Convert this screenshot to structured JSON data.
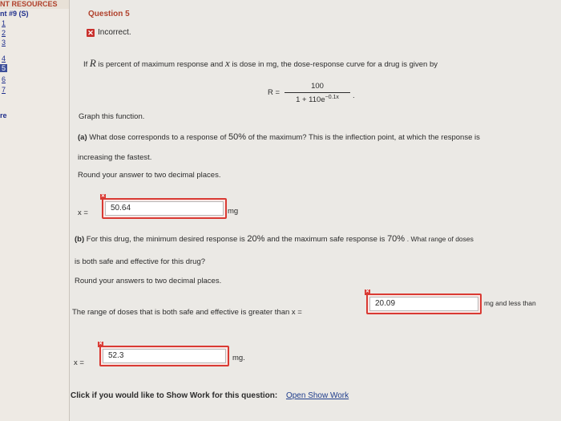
{
  "sidebar": {
    "header": "NT RESOURCES",
    "subheader": "nt #9 (S)",
    "items": [
      {
        "label": "1",
        "active": false
      },
      {
        "label": "2",
        "active": false
      },
      {
        "label": "3",
        "active": false
      },
      {
        "label": "4",
        "active": false
      },
      {
        "label": "5",
        "active": true
      },
      {
        "label": "6",
        "active": false
      },
      {
        "label": "7",
        "active": false
      }
    ],
    "footer": "re"
  },
  "question": {
    "title": "Question 5",
    "status": "Incorrect.",
    "intro": {
      "p1": "If",
      "var_R": "R",
      "p2": "is percent of maximum response and",
      "var_x": "x",
      "p3": "is dose in mg, the dose-response curve for a drug is given by"
    },
    "formula": {
      "lhs": "R =",
      "numerator": "100",
      "denominator": "1 + 110e",
      "exponent": "−0.1x",
      "trail": "."
    },
    "graph_instruction": "Graph this function.",
    "part_a": {
      "label": "(a)",
      "text1": "What dose corresponds to a response of",
      "pct": "50%",
      "text2": "of the maximum? This is the inflection point, at which the response is",
      "text3": "increasing the fastest.",
      "round": "Round your answer to two decimal places.",
      "var": "x =",
      "answer": "50.64",
      "unit": "mg"
    },
    "part_b": {
      "label": "(b)",
      "text1": "For this drug, the minimum desired response is",
      "pct_min": "20%",
      "text2": "and the maximum safe response is",
      "pct_max": "70%",
      "text3": ". What range of doses",
      "text4": "is both safe and effective for this drug?",
      "round": "Round your answers to two decimal places.",
      "range_text": "The range of doses that is both safe and effective is greater than",
      "var1": "x =",
      "answer1": "20.09",
      "unit1": "mg and less than",
      "var2": "x =",
      "answer2": "52.3",
      "unit2": "mg."
    },
    "show_work": {
      "prompt": "Click if you would like to Show Work for this question:",
      "link": "Open Show Work"
    }
  }
}
